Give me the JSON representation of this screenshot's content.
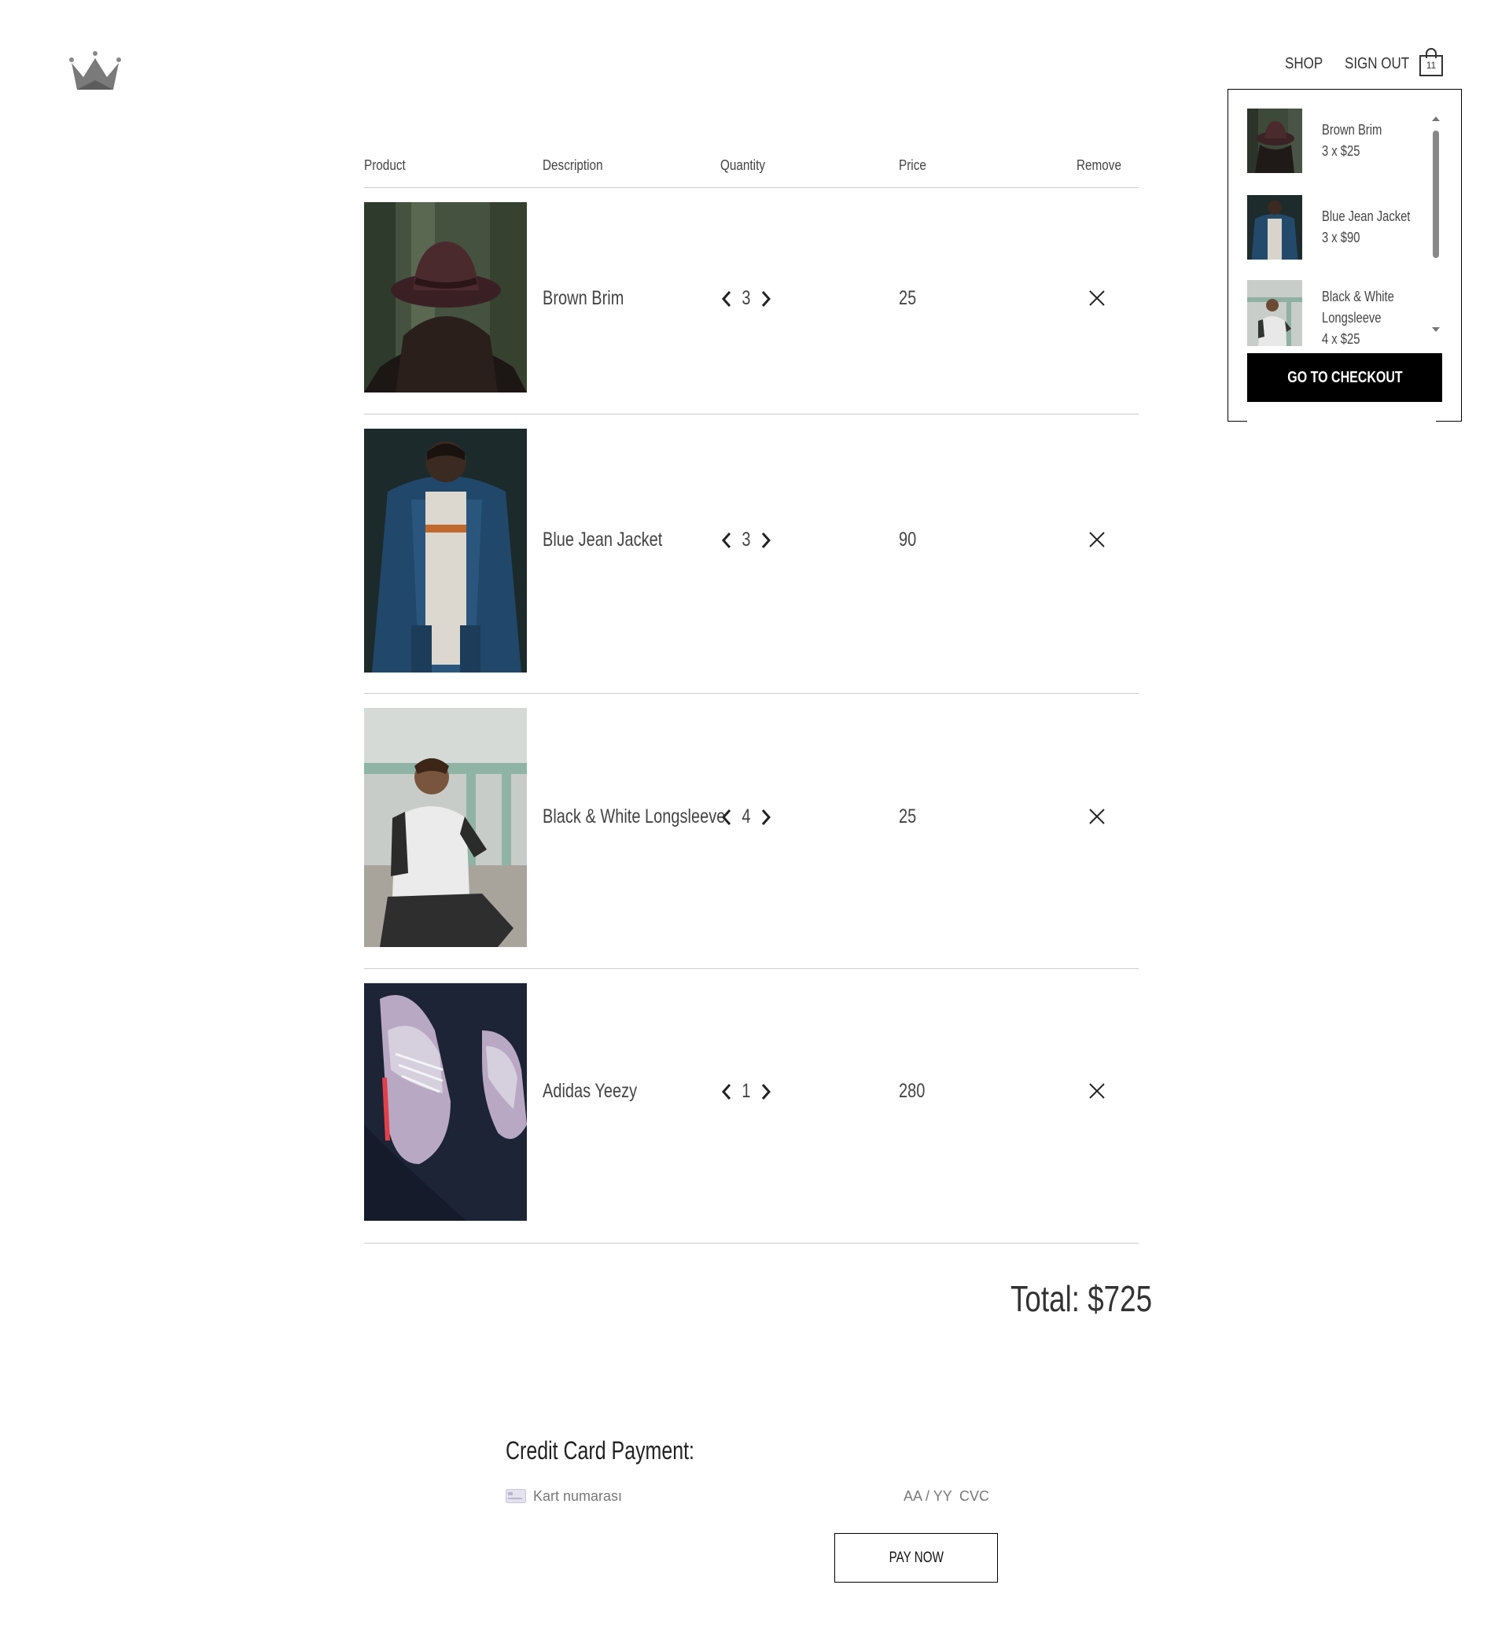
{
  "header": {
    "logo": "crown-logo",
    "nav": {
      "shop": "SHOP",
      "sign_out": "SIGN OUT"
    },
    "cart_count": "11"
  },
  "cart_dropdown": {
    "items": [
      {
        "name": "Brown Brim",
        "line1": "Brown Brim",
        "line2": "",
        "qty_price": "3 x $25"
      },
      {
        "name": "Blue Jean Jacket",
        "line1": "Blue Jean Jacket",
        "line2": "",
        "qty_price": "3 x $90"
      },
      {
        "name": "Black & White Longsleeve",
        "line1": "Black & White",
        "line2": "Longsleeve",
        "qty_price": "4 x $25"
      }
    ],
    "checkout_label": "GO TO CHECKOUT"
  },
  "table": {
    "headers": {
      "product": "Product",
      "description": "Description",
      "quantity": "Quantity",
      "price": "Price",
      "remove": "Remove"
    },
    "rows": [
      {
        "name": "Brown Brim",
        "quantity": "3",
        "price": "25"
      },
      {
        "name": "Blue Jean Jacket",
        "quantity": "3",
        "price": "90"
      },
      {
        "name": "Black & White Longsleeve",
        "quantity": "4",
        "price": "25"
      },
      {
        "name": "Adidas Yeezy",
        "quantity": "1",
        "price": "280"
      }
    ]
  },
  "total": "Total: $725",
  "payment": {
    "title": "Credit Card Payment:",
    "card_number_placeholder": "Kart numarası",
    "expiry_placeholder": "AA / YY",
    "cvc_placeholder": "CVC",
    "pay_label": "PAY NOW"
  },
  "colors": {
    "text": "#333333",
    "rule": "#cccccc",
    "button": "#000000",
    "logo": "#777777"
  }
}
